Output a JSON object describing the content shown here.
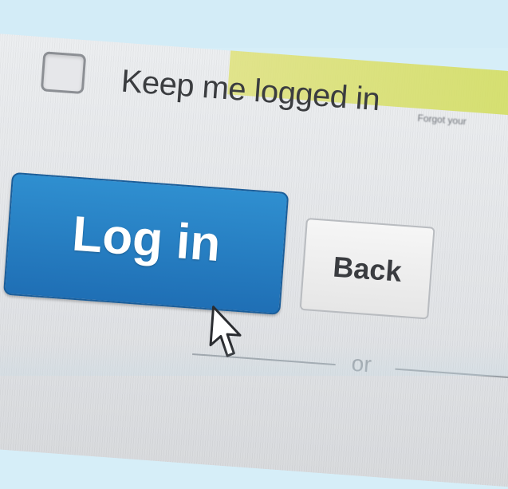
{
  "login_form": {
    "keep_logged_in_label": "Keep me logged in",
    "forgot_link": "Forgot your",
    "login_button": "Log in",
    "back_button": "Back",
    "divider_text": "or"
  },
  "colors": {
    "login_button": "#2b86cc",
    "back_button": "#eeeeee",
    "accent_strip": "#d6df64",
    "background": "#d6eef8"
  },
  "icons": [
    "checkbox",
    "mouse-pointer-icon"
  ]
}
